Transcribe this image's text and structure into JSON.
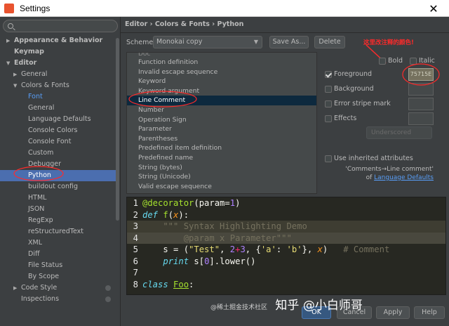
{
  "window": {
    "title": "Settings",
    "close": "✕"
  },
  "sidebar": {
    "items": [
      {
        "label": "Appearance & Behavior",
        "level": 0,
        "arrow": "▶",
        "bold": true
      },
      {
        "label": "Keymap",
        "level": 0,
        "arrow": "",
        "bold": true
      },
      {
        "label": "Editor",
        "level": 0,
        "arrow": "▼",
        "bold": true
      },
      {
        "label": "General",
        "level": 1,
        "arrow": "▶"
      },
      {
        "label": "Colors & Fonts",
        "level": 1,
        "arrow": "▼"
      },
      {
        "label": "Font",
        "level": 2,
        "arrow": "",
        "link": true
      },
      {
        "label": "General",
        "level": 2,
        "arrow": ""
      },
      {
        "label": "Language Defaults",
        "level": 2,
        "arrow": ""
      },
      {
        "label": "Console Colors",
        "level": 2,
        "arrow": ""
      },
      {
        "label": "Console Font",
        "level": 2,
        "arrow": ""
      },
      {
        "label": "Custom",
        "level": 2,
        "arrow": ""
      },
      {
        "label": "Debugger",
        "level": 2,
        "arrow": ""
      },
      {
        "label": "Python",
        "level": 2,
        "arrow": "",
        "selected": true
      },
      {
        "label": "buildout config",
        "level": 2,
        "arrow": ""
      },
      {
        "label": "HTML",
        "level": 2,
        "arrow": ""
      },
      {
        "label": "JSON",
        "level": 2,
        "arrow": ""
      },
      {
        "label": "RegExp",
        "level": 2,
        "arrow": ""
      },
      {
        "label": "reStructuredText",
        "level": 2,
        "arrow": ""
      },
      {
        "label": "XML",
        "level": 2,
        "arrow": ""
      },
      {
        "label": "Diff",
        "level": 2,
        "arrow": ""
      },
      {
        "label": "File Status",
        "level": 2,
        "arrow": ""
      },
      {
        "label": "By Scope",
        "level": 2,
        "arrow": ""
      },
      {
        "label": "Code Style",
        "level": 1,
        "arrow": "▶",
        "gear": true
      },
      {
        "label": "Inspections",
        "level": 1,
        "arrow": "",
        "gear": true
      }
    ]
  },
  "breadcrumb": "Editor › Colors & Fonts › Python",
  "scheme": {
    "label": "Scheme:",
    "value": "Monokai copy",
    "save_as": "Save As...",
    "delete": "Delete"
  },
  "attributes": {
    "partial_top": "Doc",
    "items": [
      "Function definition",
      "Invalid escape sequence",
      "Keyword",
      "Keyword argument",
      "Line Comment",
      "Number",
      "Operation Sign",
      "Parameter",
      "Parentheses",
      "Predefined item definition",
      "Predefined name",
      "String (bytes)",
      "String (Unicode)",
      "Valid escape sequence"
    ],
    "selected_index": 4
  },
  "annotation": "这里改注释的颜色!",
  "props": {
    "bold": "Bold",
    "italic": "Italic",
    "foreground": "Foreground",
    "foreground_value": "75715E",
    "foreground_color": "#75715e",
    "background": "Background",
    "error_stripe": "Error stripe mark",
    "effects": "Effects",
    "effect_type": "Underscored",
    "use_inherited": "Use inherited attributes",
    "inherit_from": "'Comments→Line comment'",
    "inherit_of": "of",
    "inherit_link": "Language Defaults"
  },
  "footer": {
    "ok": "OK",
    "cancel": "Cancel",
    "apply": "Apply",
    "help": "Help"
  },
  "watermark": {
    "handle": "@稀土掘金技术社区",
    "text": "知乎 @小白师哥"
  }
}
